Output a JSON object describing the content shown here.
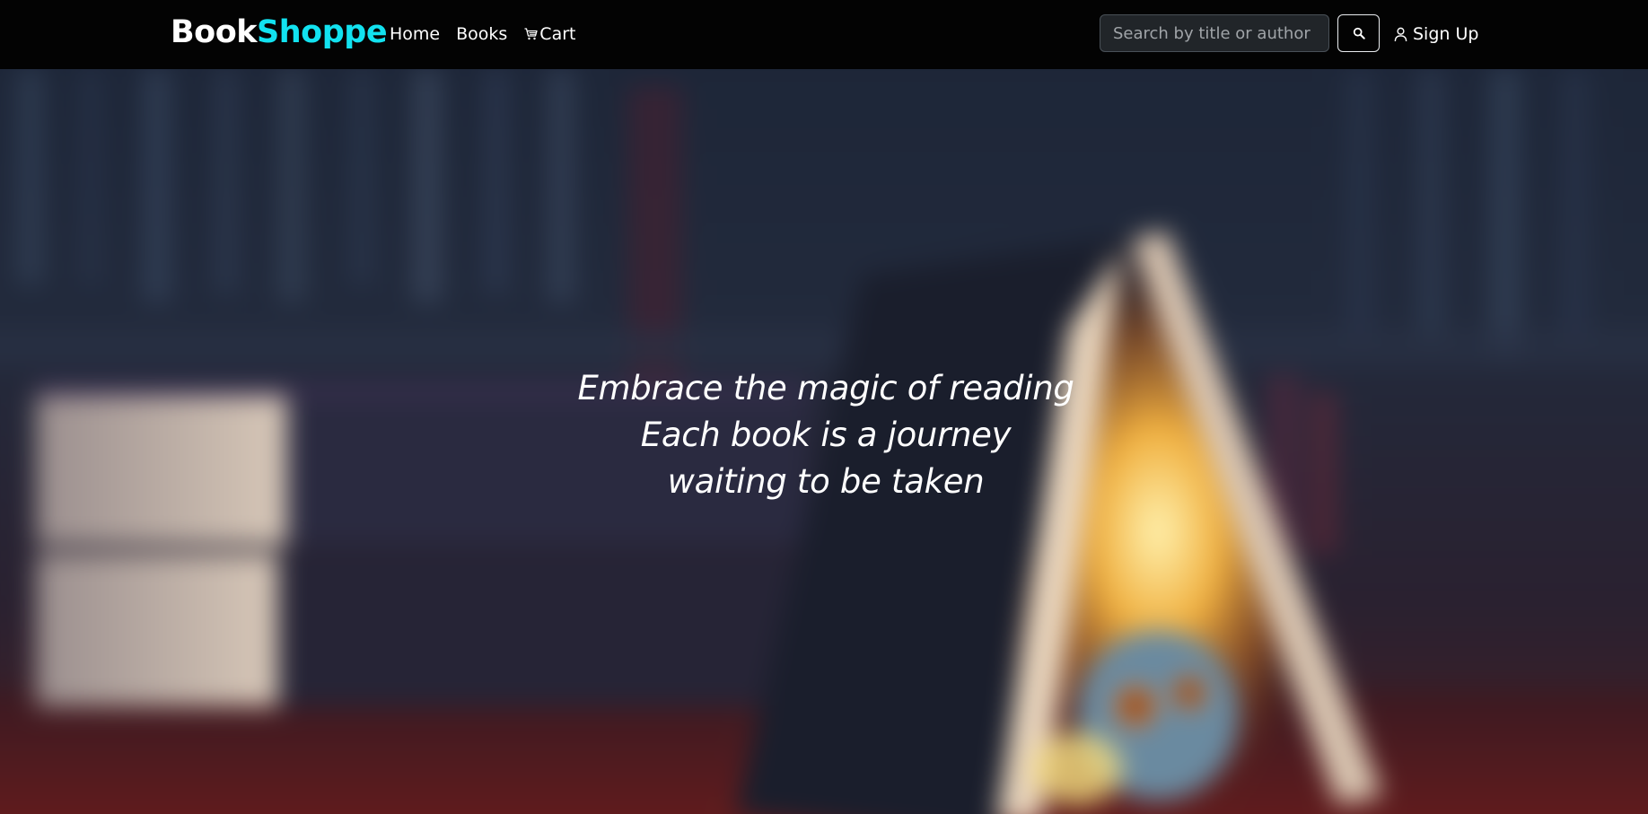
{
  "navbar": {
    "brand_part1": "Book",
    "brand_part2": "Shoppe",
    "brand_accent_color": "#12e2f0",
    "links": [
      {
        "label": "Home"
      },
      {
        "label": "Books"
      },
      {
        "label": "Cart",
        "icon": "cart-icon"
      }
    ],
    "search": {
      "placeholder": "Search by title or author",
      "value": "",
      "button_icon": "search-icon"
    },
    "signup": {
      "label": "Sign Up",
      "icon": "user-icon"
    }
  },
  "hero": {
    "lines": [
      "Embrace the magic of reading",
      "Each book is a journey",
      "waiting to be taken"
    ],
    "background": "blurred-books-image"
  },
  "colors": {
    "navbar_bg": "#030303",
    "text": "#ffffff",
    "accent": "#12e2f0"
  }
}
